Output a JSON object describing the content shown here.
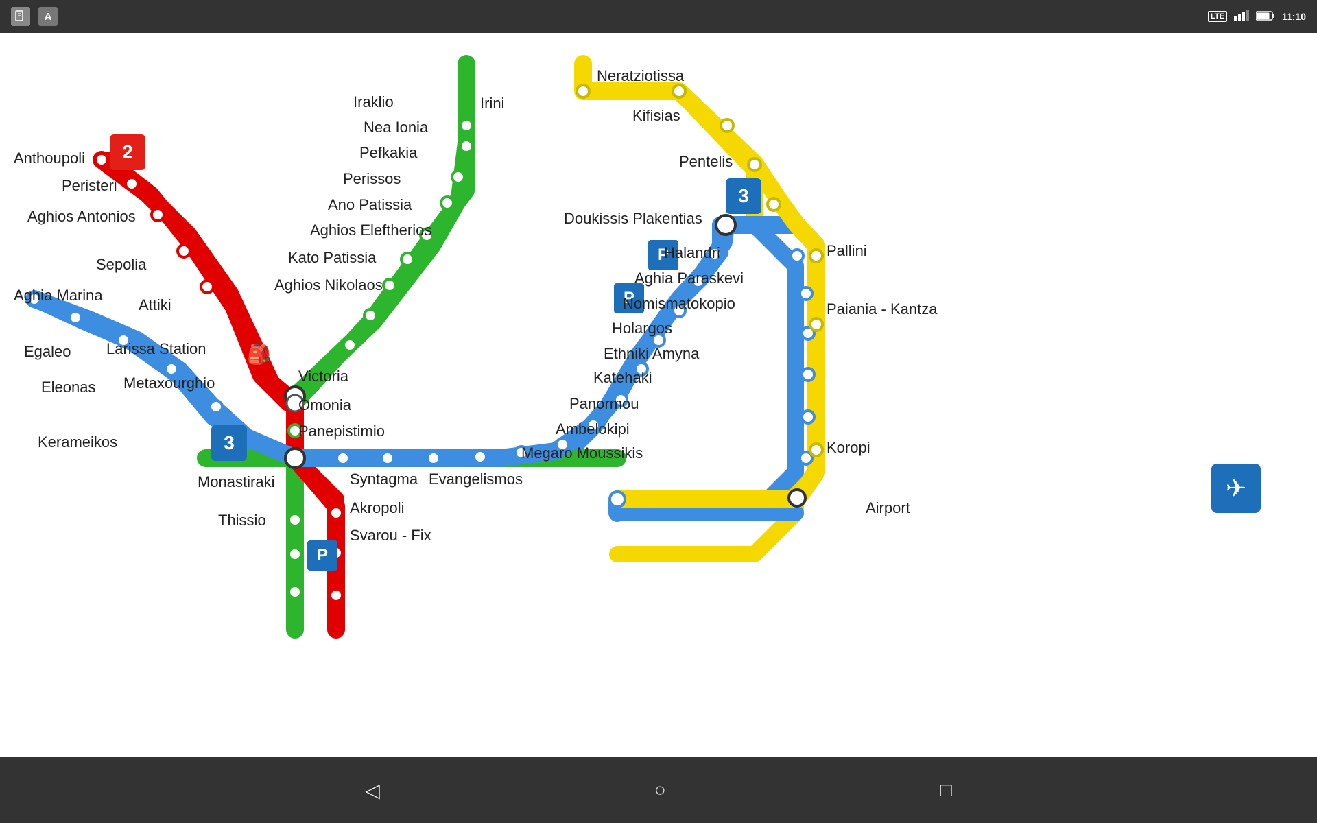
{
  "statusBar": {
    "time": "11:10",
    "lte": "LTE",
    "icons": [
      "file-icon",
      "font-icon"
    ]
  },
  "lines": {
    "red": {
      "color": "#e00000",
      "label": "2"
    },
    "green": {
      "color": "#2db52d",
      "label": ""
    },
    "blue": {
      "color": "#3d8de0",
      "label": "3"
    },
    "yellow": {
      "color": "#f5d800",
      "label": ""
    }
  },
  "stations": {
    "anthoupoli": "Anthoupoli",
    "peristeri": "Peristeri",
    "aghios_antonios": "Aghios Antonios",
    "sepolia": "Sepolia",
    "aghia_marina": "Aghia Marina",
    "egaleo": "Egaleo",
    "eleonas": "Eleonas",
    "kerameikos": "Kerameikos",
    "metaxourghio": "Metaxourghio",
    "larissa_station": "Larissa Station",
    "attiki": "Attiki",
    "thissio": "Thissio",
    "monastiraki": "Monastiraki",
    "victoria": "Victoria",
    "omonia": "Omonia",
    "panepistimio": "Panepistimio",
    "syntagma": "Syntagma",
    "akropoli": "Akropoli",
    "svarou_fix": "Svarou - Fix",
    "evangelismos": "Evangelismos",
    "megaro_moussikis": "Megaro Moussikis",
    "ambelokipi": "Ambelokipi",
    "panormou": "Panormou",
    "katehaki": "Katehaki",
    "ethniki_amyna": "Ethniki Amyna",
    "holargos": "Holargos",
    "nomismatokopio": "Nomismatokopio",
    "aghia_paraskevi": "Aghia Paraskevi",
    "halandri": "Halandri",
    "doukissis_plakentias": "Doukissis Plakentias",
    "pallini": "Pallini",
    "paiania_kantza": "Paiania - Kantza",
    "koropi": "Koropi",
    "airport": "Airport",
    "iraklio": "Iraklio",
    "irini": "Irini",
    "nea_ionia": "Nea Ionia",
    "pefkakia": "Pefkakia",
    "perissos": "Perissos",
    "ano_patissia": "Ano Patissia",
    "aghios_eleftherios": "Aghios Eleftherios",
    "kato_patissia": "Kato Patissia",
    "aghios_nikolaos": "Aghios Nikolaos",
    "neratziotissa": "Neratziotissa",
    "kifisias": "Kifisias",
    "pentelis": "Pentelis"
  },
  "navBar": {
    "back": "◁",
    "home": "○",
    "recents": "□"
  }
}
